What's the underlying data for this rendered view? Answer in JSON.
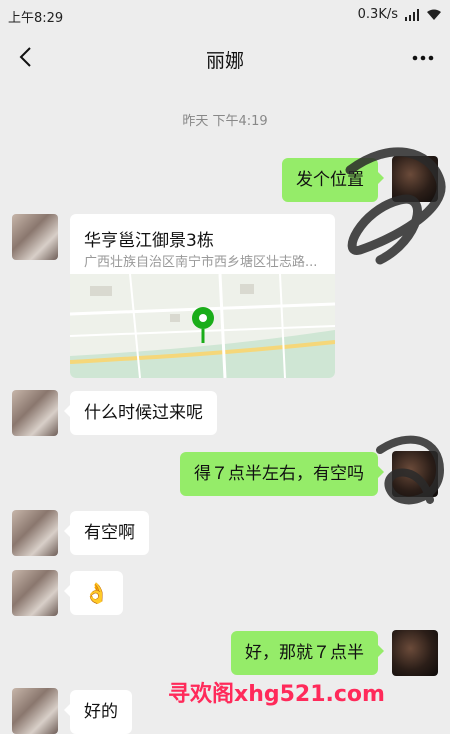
{
  "status_bar": {
    "time": "上午8:29",
    "network_speed": "0.3K/s"
  },
  "header": {
    "title": "丽娜"
  },
  "timestamp": "昨天 下午4:19",
  "location": {
    "name": "华亨邕江御景3栋",
    "address": "广西壮族自治区南宁市西乡塘区壮志路..."
  },
  "messages": [
    {
      "side": "right",
      "text": "发个位置"
    },
    {
      "side": "left",
      "text": "什么时候过来呢"
    },
    {
      "side": "right",
      "text": "得７点半左右，有空吗"
    },
    {
      "side": "left",
      "text": "有空啊"
    },
    {
      "side": "left",
      "text": "👌"
    },
    {
      "side": "right",
      "text": "好，那就７点半"
    },
    {
      "side": "left",
      "text": "好的"
    }
  ],
  "watermark": "寻欢阁xhg521.com",
  "colors": {
    "sent_bubble": "#95ec69",
    "received_bubble": "#ffffff",
    "background": "#ededed",
    "watermark": "#ff2a5a",
    "map_pin": "#1aad19"
  }
}
